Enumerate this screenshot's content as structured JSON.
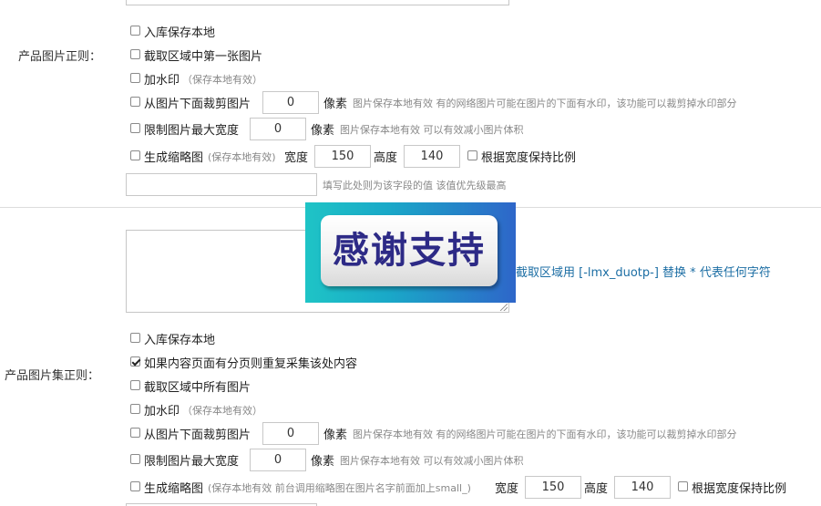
{
  "section1": {
    "label": "产品图片正则：",
    "save_local": "入库保存本地",
    "first_image": "截取区域中第一张图片",
    "watermark": "加水印",
    "watermark_hint": "（保存本地有效）",
    "crop_label": "从图片下面裁剪图片",
    "crop_value": "0",
    "crop_unit": "像素",
    "crop_hint": "图片保存本地有效 有的网络图片可能在图片的下面有水印，该功能可以裁剪掉水印部分",
    "maxwidth_label": "限制图片最大宽度",
    "maxwidth_value": "0",
    "maxwidth_unit": "像素",
    "maxwidth_hint": "图片保存本地有效 可以有效减小图片体积",
    "thumb_label": "生成缩略图",
    "thumb_hint": "(保存本地有效)",
    "width_label": "宽度",
    "width_value": "150",
    "height_label": "高度",
    "height_value": "140",
    "keep_ratio": "根据宽度保持比例",
    "default_value": "",
    "default_hint": "填写此处则为该字段的值 该值优先级最高"
  },
  "overlay": {
    "text": "感谢支持",
    "right_hint": "截取区域用 [-lmx_duotp-] 替换 * 代表任何字符"
  },
  "section2": {
    "label": "产品图片集正则：",
    "save_local": "入库保存本地",
    "repeat_pages": "如果内容页面有分页则重复采集该处内容",
    "repeat_pages_checked": true,
    "all_images": "截取区域中所有图片",
    "watermark": "加水印",
    "watermark_hint": "（保存本地有效）",
    "crop_label": "从图片下面裁剪图片",
    "crop_value": "0",
    "crop_unit": "像素",
    "crop_hint": "图片保存本地有效 有的网络图片可能在图片的下面有水印，该功能可以裁剪掉水印部分",
    "maxwidth_label": "限制图片最大宽度",
    "maxwidth_value": "0",
    "maxwidth_unit": "像素",
    "maxwidth_hint": "图片保存本地有效 可以有效减小图片体积",
    "thumb_label": "生成缩略图",
    "thumb_hint": "(保存本地有效 前台调用缩略图在图片名字前面加上small_)",
    "width_label": "宽度",
    "width_value": "150",
    "height_label": "高度",
    "height_value": "140",
    "keep_ratio": "根据宽度保持比例"
  }
}
